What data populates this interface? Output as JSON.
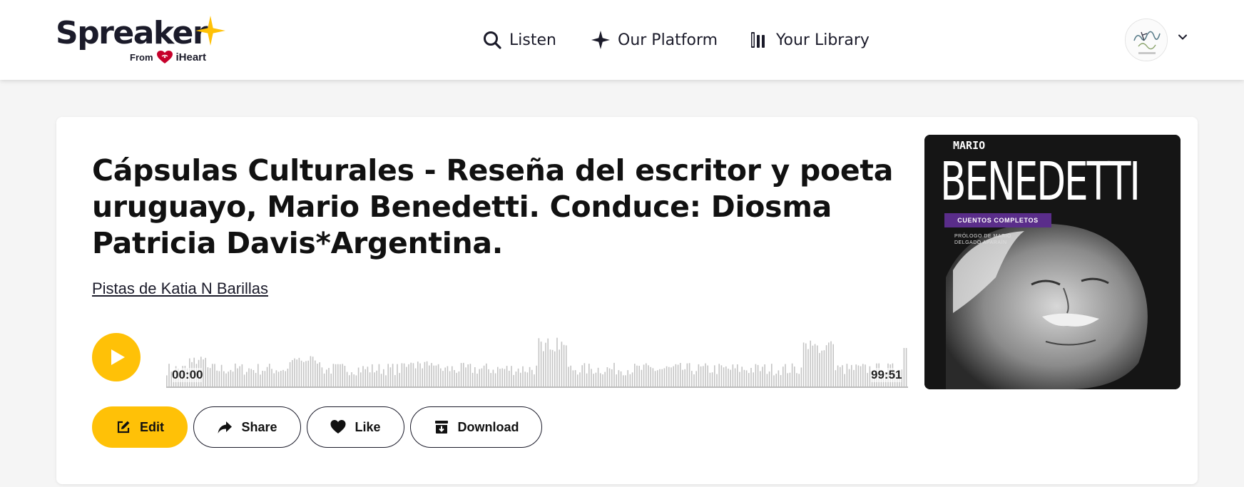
{
  "header": {
    "logo_word": "Spreaker",
    "logo_from": "From",
    "logo_brand": "iHeart",
    "nav": [
      {
        "label": "Listen",
        "icon": "search-icon"
      },
      {
        "label": "Our Platform",
        "icon": "star-icon"
      },
      {
        "label": "Your Library",
        "icon": "library-icon"
      }
    ],
    "avatar_icon": "user-avatar",
    "menu_icon": "chevron-down-icon"
  },
  "episode": {
    "title": "Cápsulas Culturales - Reseña del escritor y poeta uruguayo, Mario Benedetti. Conduce: Diosma Patricia Davis*Argentina.",
    "author": "Pistas de Katia N Barillas",
    "player": {
      "current_time": "00:00",
      "duration": "99:51",
      "progress": 0
    },
    "actions": {
      "edit": "Edit",
      "share": "Share",
      "like": "Like",
      "download": "Download"
    },
    "cover": {
      "small_text": "MARIO",
      "big_text": "BENEDETTI",
      "badge": "CUENTOS COMPLETOS",
      "prologue": "PRÓLOGO DE MARIO DELGADO APARAÍN"
    }
  },
  "colors": {
    "accent": "#ffc107",
    "text": "#111111",
    "page_bg": "#f5f5f5",
    "waveform": "#c4c4c4",
    "cover_badge": "#5a2d8a"
  }
}
